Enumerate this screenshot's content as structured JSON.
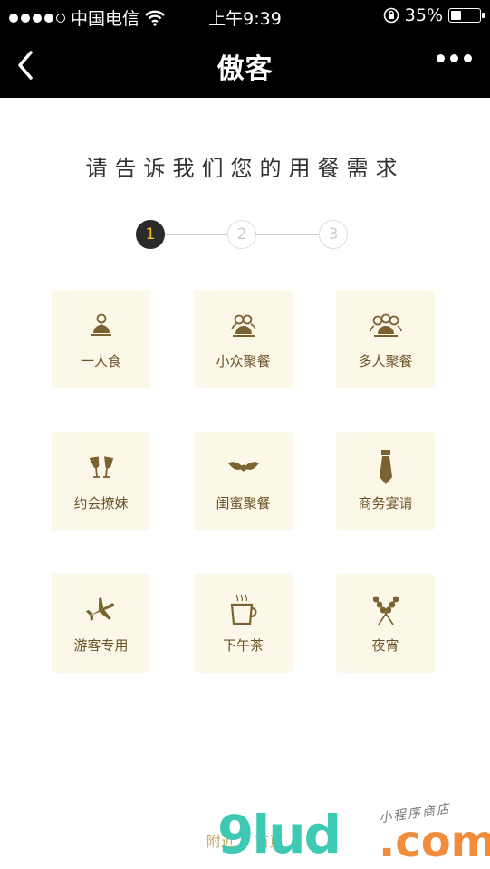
{
  "status_bar": {
    "carrier": "中国电信",
    "time": "上午9:39",
    "battery_percent": "35%",
    "battery_level": 0.35
  },
  "nav": {
    "title": "傲客"
  },
  "heading": "请告诉我们您的用餐需求",
  "stepper": {
    "steps": [
      "1",
      "2",
      "3"
    ],
    "active_step": 1
  },
  "options": [
    {
      "label": "一人食",
      "icon": "single-diner-icon"
    },
    {
      "label": "小众聚餐",
      "icon": "small-group-icon"
    },
    {
      "label": "多人聚餐",
      "icon": "large-group-icon"
    },
    {
      "label": "约会撩妹",
      "icon": "champagne-glasses-icon"
    },
    {
      "label": "闺蜜聚餐",
      "icon": "bow-icon"
    },
    {
      "label": "商务宴请",
      "icon": "necktie-icon"
    },
    {
      "label": "游客专用",
      "icon": "airplane-icon"
    },
    {
      "label": "下午茶",
      "icon": "tea-cup-icon"
    },
    {
      "label": "夜宵",
      "icon": "skewers-icon"
    }
  ],
  "footer": {
    "nearby": "附近",
    "home": "首页",
    "separator": "|"
  },
  "watermark": {
    "main": "9lud",
    "domain": ".com",
    "sub": "小程序商店"
  },
  "colors": {
    "topbar": "#000000",
    "card_bg": "#fcf8e9",
    "icon_color": "#7a6330",
    "label_color": "#6a5427",
    "step_active_bg": "#2b2b2b",
    "step_active_text": "#f0c41b"
  }
}
